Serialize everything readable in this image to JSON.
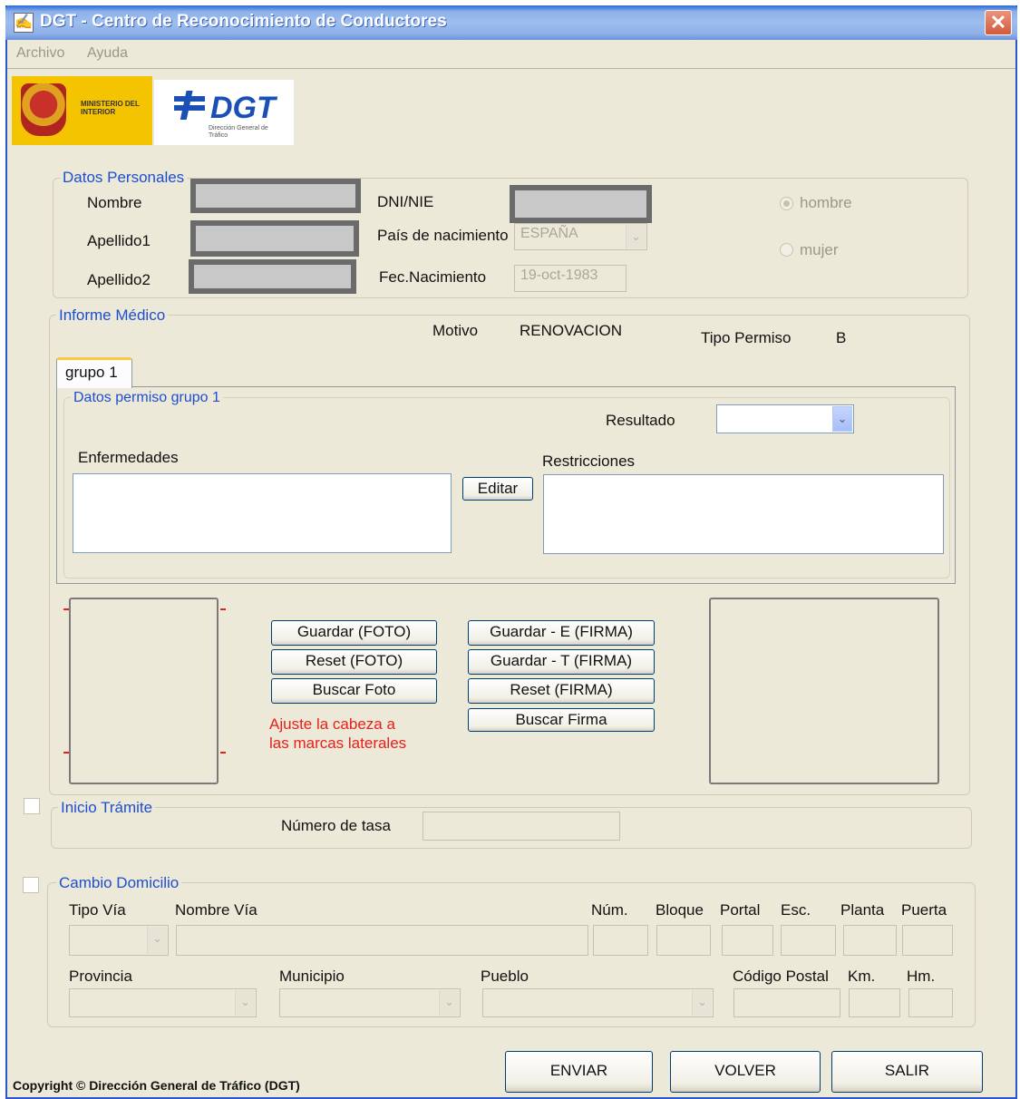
{
  "window": {
    "title": "DGT - Centro de Reconocimiento de Conductores",
    "app_icon": "pen-document-icon",
    "close_label": "✕"
  },
  "menu": {
    "items": [
      "Archivo",
      "Ayuda"
    ]
  },
  "logos": {
    "ministerio": "MINISTERIO DEL INTERIOR",
    "dgt": "DGT",
    "dgt_sub": "Dirección General de Tráfico"
  },
  "datos_personales": {
    "legend": "Datos Personales",
    "nombre_label": "Nombre",
    "apellido1_label": "Apellido1",
    "apellido2_label": "Apellido2",
    "dni_label": "DNI/NIE",
    "pais_label": "País de nacimiento",
    "pais_value": "ESPAÑA",
    "fecha_label": "Fec.Nacimiento",
    "fecha_value": "19-oct-1983",
    "hombre_label": "hombre",
    "mujer_label": "mujer",
    "sexo_selected": "hombre"
  },
  "informe": {
    "legend": "Informe Médico",
    "motivo_label": "Motivo",
    "motivo_value": "RENOVACION",
    "tipo_permiso_label": "Tipo Permiso",
    "tipo_permiso_value": "B",
    "tab_label": "grupo 1",
    "grupo_legend": "Datos permiso grupo 1",
    "resultado_label": "Resultado",
    "resultado_value": "",
    "enfermedades_label": "Enfermedades",
    "restricciones_label": "Restricciones",
    "editar_label": "Editar"
  },
  "foto_firma": {
    "guardar_foto": "Guardar (FOTO)",
    "reset_foto": "Reset (FOTO)",
    "buscar_foto": "Buscar Foto",
    "hint_line1": "Ajuste la cabeza a",
    "hint_line2": "las marcas laterales",
    "guardar_e_firma": "Guardar - E (FIRMA)",
    "guardar_t_firma": "Guardar - T (FIRMA)",
    "reset_firma": "Reset (FIRMA)",
    "buscar_firma": "Buscar Firma"
  },
  "inicio_tramite": {
    "legend": "Inicio Trámite",
    "numero_tasa_label": "Número de tasa",
    "checked": false
  },
  "cambio_domicilio": {
    "legend": "Cambio Domicilio",
    "checked": false,
    "tipo_via": "Tipo Vía",
    "nombre_via": "Nombre Vía",
    "num": "Núm.",
    "bloque": "Bloque",
    "portal": "Portal",
    "esc": "Esc.",
    "planta": "Planta",
    "puerta": "Puerta",
    "provincia": "Provincia",
    "municipio": "Municipio",
    "pueblo": "Pueblo",
    "codigo_postal": "Código Postal",
    "km": "Km.",
    "hm": "Hm."
  },
  "footer": {
    "copyright": "Copyright © Dirección General de Tráfico (DGT)",
    "enviar": "ENVIAR",
    "volver": "VOLVER",
    "salir": "SALIR"
  },
  "colors": {
    "legend_blue": "#1d4ed1",
    "hint_red": "#e8201c",
    "titlebar_blue": "#2a6bd8"
  }
}
